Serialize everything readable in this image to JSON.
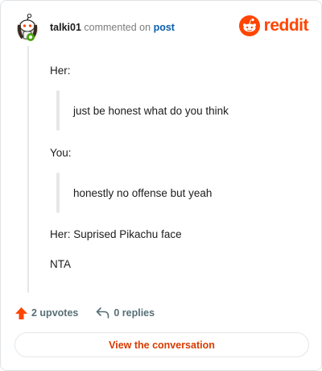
{
  "comment": {
    "author": "talki01",
    "action_text": "commented on",
    "post_link": "post"
  },
  "brand": {
    "wordmark": "reddit",
    "color": "#ff4500"
  },
  "body": {
    "line1": "Her:",
    "quote1": "just be honest what do you think",
    "line2": "You:",
    "quote2": "honestly no offense but yeah",
    "line3": "Her: Suprised Pikachu face",
    "line4": "NTA"
  },
  "footer": {
    "upvotes": "2 upvotes",
    "replies": "0 replies",
    "upvote_icon": "upvote-arrow-icon",
    "reply_icon": "reply-arrow-icon"
  },
  "cta": {
    "label": "View the conversation",
    "color": "#d93a00"
  }
}
